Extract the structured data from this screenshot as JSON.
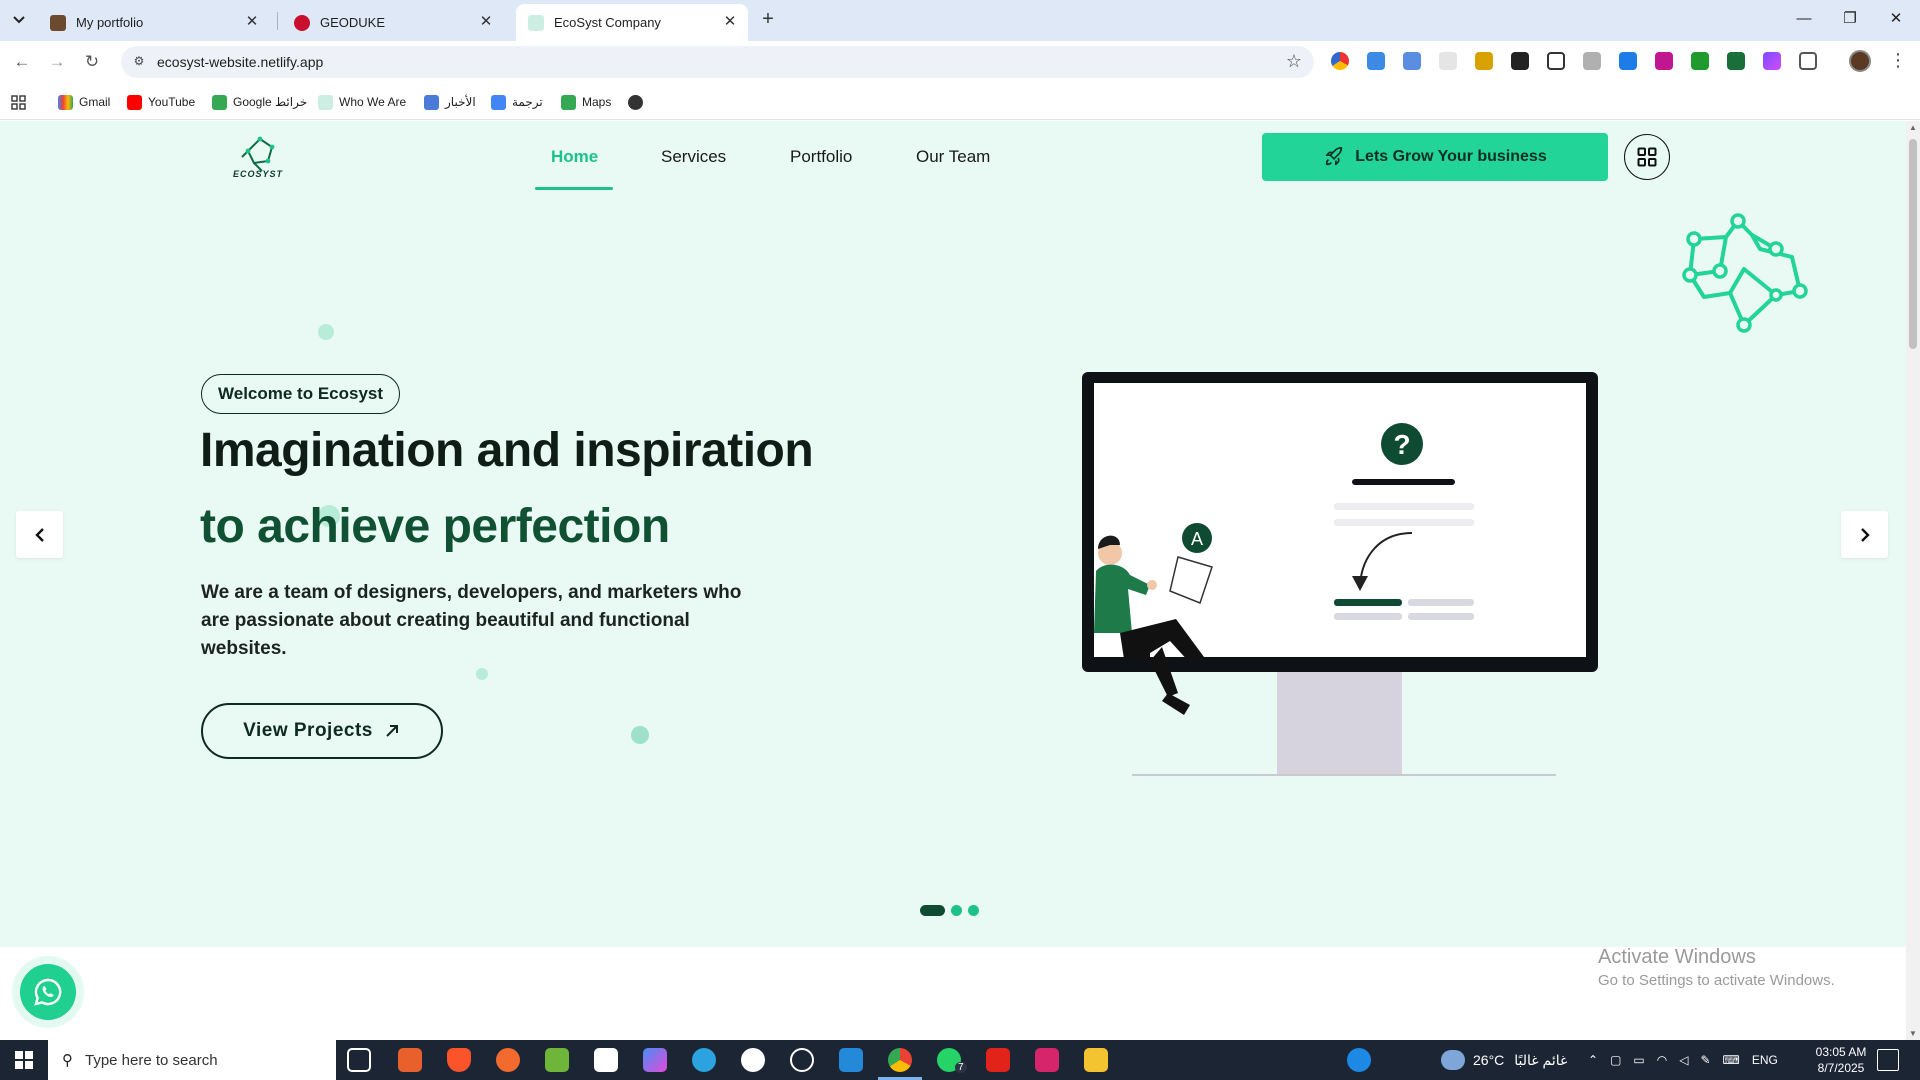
{
  "browser": {
    "tabs": [
      {
        "title": "My portfolio",
        "active": false
      },
      {
        "title": "GEODUKE",
        "active": false
      },
      {
        "title": "EcoSyst Company",
        "active": true
      }
    ],
    "url": "ecosyst-website.netlify.app",
    "bookmarks": [
      "Gmail",
      "YouTube",
      "Google خرائط",
      "Who We Are",
      "الأخبار",
      "ترجمة",
      "Maps"
    ]
  },
  "site": {
    "logo_text": "ECOSYST",
    "nav": [
      {
        "label": "Home",
        "active": true
      },
      {
        "label": "Services",
        "active": false
      },
      {
        "label": "Portfolio",
        "active": false
      },
      {
        "label": "Our Team",
        "active": false
      }
    ],
    "cta_label": "Lets Grow Your business",
    "hero": {
      "badge": "Welcome to Ecosyst",
      "title_line1": "Imagination and inspiration",
      "title_line2": "to achieve perfection",
      "description": "We are a team of designers, developers, and marketers who are passionate about creating beautiful and functional websites.",
      "button_label": "View Projects",
      "illustration_letter": "A",
      "illustration_symbol": "?"
    },
    "carousel": {
      "slides": 3,
      "active_index": 0
    },
    "colors": {
      "accent": "#22d497",
      "dark_green": "#0f5132",
      "hero_bg": "#e9f9f4"
    }
  },
  "watermark": {
    "line1": "Activate Windows",
    "line2": "Go to Settings to activate Windows."
  },
  "taskbar": {
    "search_placeholder": "Type here to search",
    "weather_temp": "26°C",
    "weather_text": "غائم غالبًا",
    "language": "ENG",
    "time": "03:05 AM",
    "date": "8/7/2025",
    "whatsapp_badge": "7"
  }
}
